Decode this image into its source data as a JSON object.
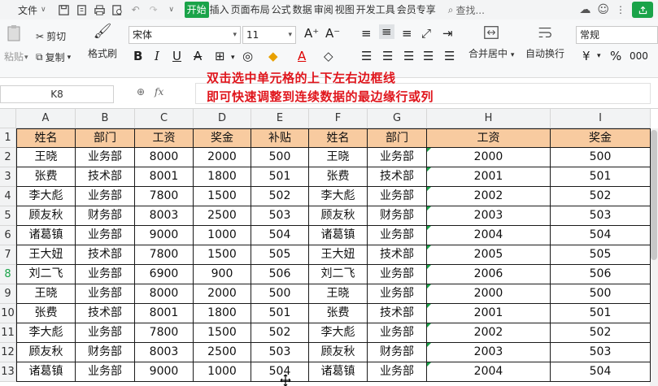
{
  "menu": {
    "file_label": "文件",
    "tabs": [
      "开始",
      "插入",
      "页面布局",
      "公式",
      "数据",
      "审阅",
      "视图",
      "开发工具",
      "会员专享"
    ],
    "active_tab": "开始",
    "search_label": "查找..."
  },
  "ribbon": {
    "paste_label": "粘贴",
    "cut_label": "剪切",
    "copy_label": "复制",
    "format_painter_label": "格式刷",
    "font_name": "宋体",
    "font_size": "11",
    "merge_label": "合并居中",
    "wrap_label": "自动换行",
    "number_format": "常规",
    "currency_symbol": "¥",
    "percent_symbol": "%",
    "thousands_symbol": "000"
  },
  "formula_bar": {
    "cell_ref": "K8",
    "fx_label": "fx"
  },
  "tip": {
    "line1": "双击选中单元格的上下左右边框线",
    "line2": "即可快速调整到连续数据的最边缘行或列"
  },
  "sheet": {
    "columns": [
      "A",
      "B",
      "C",
      "D",
      "E",
      "F",
      "G",
      "H",
      "I"
    ],
    "row_numbers": [
      "1",
      "2",
      "3",
      "4",
      "5",
      "6",
      "7",
      "8",
      "9",
      "10",
      "11",
      "12",
      "13"
    ],
    "active_row": "8",
    "rows": [
      [
        "姓名",
        "部门",
        "工资",
        "奖金",
        "补贴",
        "姓名",
        "部门",
        "工资",
        "奖金"
      ],
      [
        "王晓",
        "业务部",
        "8000",
        "2000",
        "500",
        "王晓",
        "业务部",
        "2000",
        "500"
      ],
      [
        "张费",
        "技术部",
        "8001",
        "1800",
        "501",
        "张费",
        "技术部",
        "2001",
        "501"
      ],
      [
        "李大彪",
        "业务部",
        "7800",
        "1500",
        "502",
        "李大彪",
        "业务部",
        "2002",
        "502"
      ],
      [
        "顾友秋",
        "财务部",
        "8003",
        "2500",
        "503",
        "顾友秋",
        "财务部",
        "2003",
        "503"
      ],
      [
        "诸葛镇",
        "业务部",
        "9000",
        "1000",
        "504",
        "诸葛镇",
        "业务部",
        "2004",
        "504"
      ],
      [
        "王大妞",
        "技术部",
        "7800",
        "1500",
        "505",
        "王大妞",
        "技术部",
        "2005",
        "505"
      ],
      [
        "刘二飞",
        "业务部",
        "6900",
        "900",
        "506",
        "刘二飞",
        "业务部",
        "2006",
        "506"
      ],
      [
        "王晓",
        "业务部",
        "8000",
        "2000",
        "500",
        "王晓",
        "业务部",
        "2000",
        "500"
      ],
      [
        "张费",
        "技术部",
        "8001",
        "1800",
        "501",
        "张费",
        "技术部",
        "2001",
        "501"
      ],
      [
        "李大彪",
        "业务部",
        "7800",
        "1500",
        "502",
        "李大彪",
        "业务部",
        "2002",
        "502"
      ],
      [
        "顾友秋",
        "财务部",
        "8003",
        "2500",
        "503",
        "顾友秋",
        "财务部",
        "2003",
        "503"
      ],
      [
        "诸葛镇",
        "业务部",
        "9000",
        "1000",
        "504",
        "诸葛镇",
        "业务部",
        "2004",
        "504"
      ]
    ],
    "header_fill": "#f8cba0",
    "accent": "#1aa349"
  }
}
